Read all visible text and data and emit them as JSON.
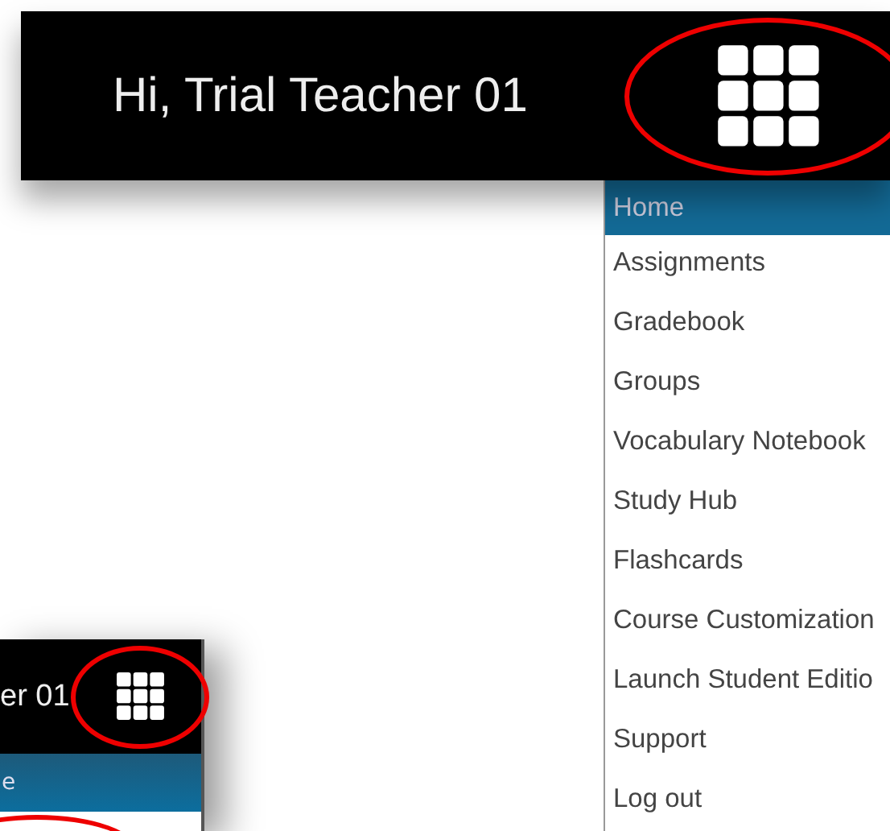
{
  "header": {
    "greeting": "Hi, Trial Teacher 01"
  },
  "menu": {
    "items": [
      {
        "label": "Home",
        "selected": true
      },
      {
        "label": "Assignments",
        "selected": false
      },
      {
        "label": "Gradebook",
        "selected": false
      },
      {
        "label": "Groups",
        "selected": false
      },
      {
        "label": "Vocabulary Notebook",
        "selected": false
      },
      {
        "label": "Study Hub",
        "selected": false
      },
      {
        "label": "Flashcards",
        "selected": false
      },
      {
        "label": "Course Customization",
        "selected": false
      },
      {
        "label": "Launch Student Editio",
        "selected": false
      },
      {
        "label": "Support",
        "selected": false
      },
      {
        "label": "Log out",
        "selected": false
      }
    ]
  },
  "inset": {
    "greeting": "er 01",
    "menu_items": [
      {
        "label": "e",
        "selected": true
      }
    ]
  }
}
